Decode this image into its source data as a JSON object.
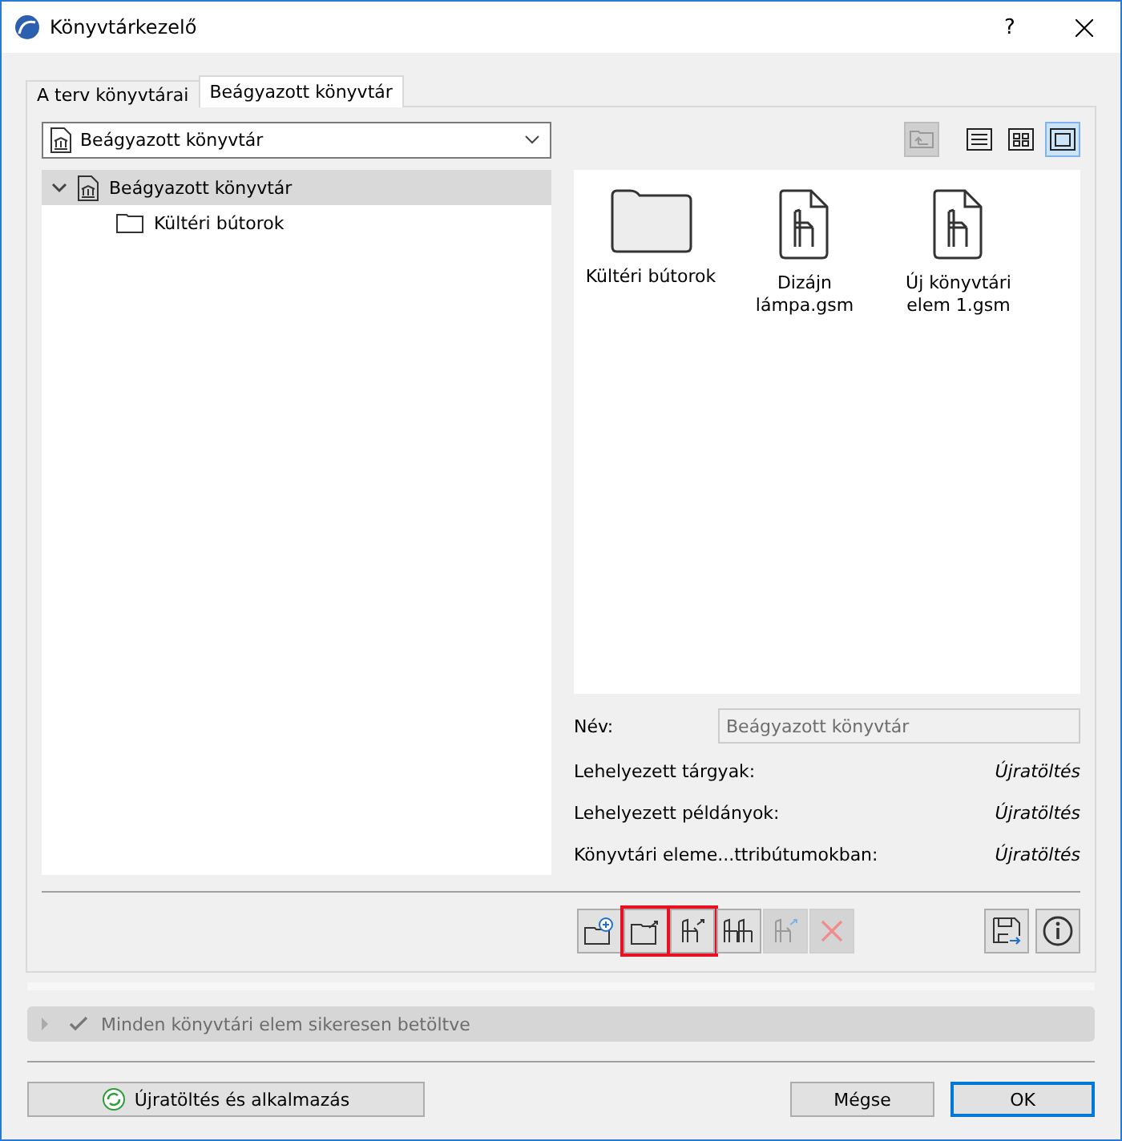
{
  "window": {
    "title": "Könyvtárkezelő",
    "help": "?"
  },
  "tabs": [
    {
      "label": "A terv könyvtárai",
      "selected": false
    },
    {
      "label": "Beágyazott könyvtár",
      "selected": true
    }
  ],
  "library_select": {
    "value": "Beágyazott könyvtár"
  },
  "up_button": {
    "disabled": true
  },
  "view_toggles": [
    {
      "kind": "list",
      "selected": false
    },
    {
      "kind": "grid",
      "selected": false
    },
    {
      "kind": "preview",
      "selected": true
    }
  ],
  "tree": [
    {
      "label": "Beágyazott könyvtár",
      "kind": "library",
      "expanded": true,
      "selected": true,
      "children": [
        {
          "label": "Kültéri bútorok",
          "kind": "folder",
          "selected": false
        }
      ]
    }
  ],
  "items": [
    {
      "label": "Kültéri bútorok",
      "kind": "folder"
    },
    {
      "label": "Dizájn lámpa.gsm",
      "kind": "object"
    },
    {
      "label": "Új könyvtári elem 1.gsm",
      "kind": "object"
    }
  ],
  "details": {
    "name_label": "Név:",
    "name_value": "Beágyazott könyvtár",
    "rows": [
      {
        "label": "Lehelyezett tárgyak:",
        "value": "Újratöltés"
      },
      {
        "label": "Lehelyezett példányok:",
        "value": "Újratöltés"
      },
      {
        "label": "Könyvtári eleme...ttribútumokban:",
        "value": "Újratöltés"
      }
    ]
  },
  "toolbar": [
    {
      "kind": "new-folder",
      "highlighted": false,
      "disabled": false
    },
    {
      "kind": "export-folder",
      "highlighted": true,
      "disabled": false
    },
    {
      "kind": "export-object",
      "highlighted": true,
      "disabled": false
    },
    {
      "kind": "objects",
      "highlighted": false,
      "disabled": false
    },
    {
      "kind": "move-object",
      "highlighted": false,
      "disabled": true
    },
    {
      "kind": "delete",
      "highlighted": false,
      "disabled": true
    }
  ],
  "toolbar_right": [
    {
      "kind": "save"
    },
    {
      "kind": "info"
    }
  ],
  "status": {
    "text": "Minden könyvtári elem sikeresen betöltve",
    "expanded": false
  },
  "footer": {
    "reload": "Újratöltés és alkalmazás",
    "cancel": "Mégse",
    "ok": "OK"
  }
}
